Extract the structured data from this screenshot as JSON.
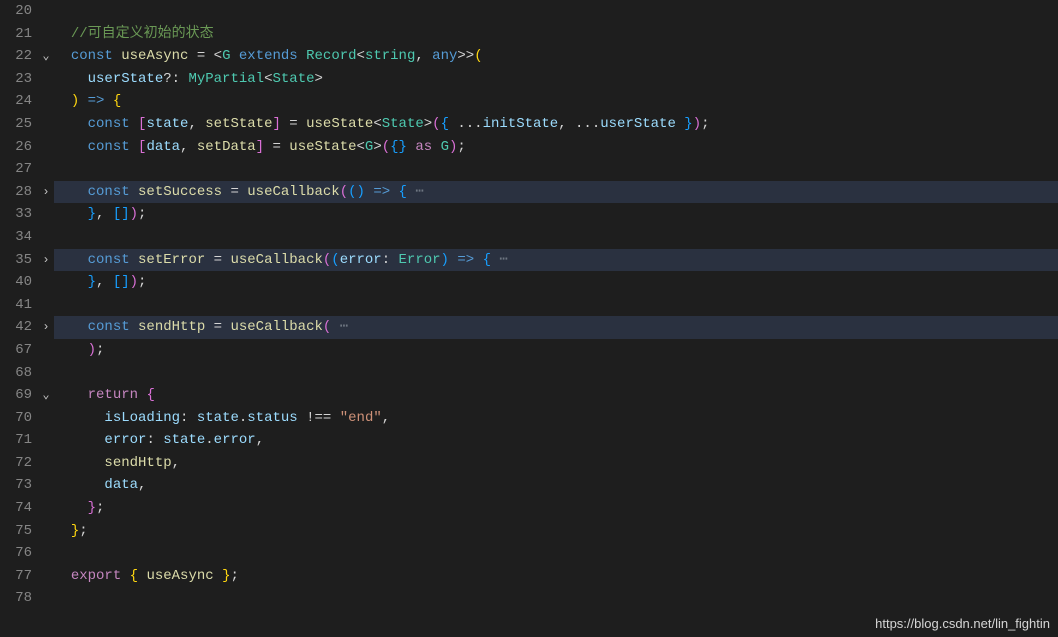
{
  "watermark": "https://blog.csdn.net/lin_fightin",
  "lines": [
    {
      "num": "20",
      "fold": "",
      "hl": false,
      "tokens": []
    },
    {
      "num": "21",
      "fold": "",
      "hl": false,
      "tokens": [
        {
          "t": "  ",
          "c": ""
        },
        {
          "t": "//可自定义初始的状态",
          "c": "comment"
        }
      ]
    },
    {
      "num": "22",
      "fold": "v",
      "hl": false,
      "tokens": [
        {
          "t": "  ",
          "c": ""
        },
        {
          "t": "const",
          "c": "storage"
        },
        {
          "t": " ",
          "c": ""
        },
        {
          "t": "useAsync",
          "c": "func"
        },
        {
          "t": " ",
          "c": ""
        },
        {
          "t": "=",
          "c": "op"
        },
        {
          "t": " ",
          "c": ""
        },
        {
          "t": "<",
          "c": "punc"
        },
        {
          "t": "G",
          "c": "type"
        },
        {
          "t": " ",
          "c": ""
        },
        {
          "t": "extends",
          "c": "storage"
        },
        {
          "t": " ",
          "c": ""
        },
        {
          "t": "Record",
          "c": "type"
        },
        {
          "t": "<",
          "c": "punc"
        },
        {
          "t": "string",
          "c": "type"
        },
        {
          "t": ",",
          "c": "punc"
        },
        {
          "t": " ",
          "c": ""
        },
        {
          "t": "any",
          "c": "storage"
        },
        {
          "t": ">>",
          "c": "punc"
        },
        {
          "t": "(",
          "c": "paren1"
        }
      ]
    },
    {
      "num": "23",
      "fold": "",
      "hl": false,
      "tokens": [
        {
          "t": "    ",
          "c": ""
        },
        {
          "t": "userState",
          "c": "var"
        },
        {
          "t": "?:",
          "c": "punc"
        },
        {
          "t": " ",
          "c": ""
        },
        {
          "t": "MyPartial",
          "c": "type"
        },
        {
          "t": "<",
          "c": "punc"
        },
        {
          "t": "State",
          "c": "type"
        },
        {
          "t": ">",
          "c": "punc"
        }
      ]
    },
    {
      "num": "24",
      "fold": "",
      "hl": false,
      "tokens": [
        {
          "t": "  ",
          "c": ""
        },
        {
          "t": ")",
          "c": "paren1"
        },
        {
          "t": " ",
          "c": ""
        },
        {
          "t": "=>",
          "c": "storage"
        },
        {
          "t": " ",
          "c": ""
        },
        {
          "t": "{",
          "c": "brace"
        }
      ]
    },
    {
      "num": "25",
      "fold": "",
      "hl": false,
      "tokens": [
        {
          "t": "    ",
          "c": ""
        },
        {
          "t": "const",
          "c": "storage"
        },
        {
          "t": " ",
          "c": ""
        },
        {
          "t": "[",
          "c": "bracket"
        },
        {
          "t": "state",
          "c": "var"
        },
        {
          "t": ",",
          "c": "punc"
        },
        {
          "t": " ",
          "c": ""
        },
        {
          "t": "setState",
          "c": "func"
        },
        {
          "t": "]",
          "c": "bracket"
        },
        {
          "t": " ",
          "c": ""
        },
        {
          "t": "=",
          "c": "op"
        },
        {
          "t": " ",
          "c": ""
        },
        {
          "t": "useState",
          "c": "func"
        },
        {
          "t": "<",
          "c": "punc"
        },
        {
          "t": "State",
          "c": "type"
        },
        {
          "t": ">",
          "c": "punc"
        },
        {
          "t": "(",
          "c": "paren2"
        },
        {
          "t": "{",
          "c": "paren3"
        },
        {
          "t": " ",
          "c": ""
        },
        {
          "t": "...",
          "c": "punc"
        },
        {
          "t": "initState",
          "c": "var"
        },
        {
          "t": ",",
          "c": "punc"
        },
        {
          "t": " ",
          "c": ""
        },
        {
          "t": "...",
          "c": "punc"
        },
        {
          "t": "userState",
          "c": "var"
        },
        {
          "t": " ",
          "c": ""
        },
        {
          "t": "}",
          "c": "paren3"
        },
        {
          "t": ")",
          "c": "paren2"
        },
        {
          "t": ";",
          "c": "punc"
        }
      ]
    },
    {
      "num": "26",
      "fold": "",
      "hl": false,
      "tokens": [
        {
          "t": "    ",
          "c": ""
        },
        {
          "t": "const",
          "c": "storage"
        },
        {
          "t": " ",
          "c": ""
        },
        {
          "t": "[",
          "c": "bracket"
        },
        {
          "t": "data",
          "c": "var"
        },
        {
          "t": ",",
          "c": "punc"
        },
        {
          "t": " ",
          "c": ""
        },
        {
          "t": "setData",
          "c": "func"
        },
        {
          "t": "]",
          "c": "bracket"
        },
        {
          "t": " ",
          "c": ""
        },
        {
          "t": "=",
          "c": "op"
        },
        {
          "t": " ",
          "c": ""
        },
        {
          "t": "useState",
          "c": "func"
        },
        {
          "t": "<",
          "c": "punc"
        },
        {
          "t": "G",
          "c": "type"
        },
        {
          "t": ">",
          "c": "punc"
        },
        {
          "t": "(",
          "c": "paren2"
        },
        {
          "t": "{}",
          "c": "paren3"
        },
        {
          "t": " ",
          "c": ""
        },
        {
          "t": "as",
          "c": "keyword"
        },
        {
          "t": " ",
          "c": ""
        },
        {
          "t": "G",
          "c": "type"
        },
        {
          "t": ")",
          "c": "paren2"
        },
        {
          "t": ";",
          "c": "punc"
        }
      ]
    },
    {
      "num": "27",
      "fold": "",
      "hl": false,
      "tokens": []
    },
    {
      "num": "28",
      "fold": ">",
      "hl": true,
      "tokens": [
        {
          "t": "    ",
          "c": ""
        },
        {
          "t": "const",
          "c": "storage"
        },
        {
          "t": " ",
          "c": ""
        },
        {
          "t": "setSuccess",
          "c": "func"
        },
        {
          "t": " ",
          "c": ""
        },
        {
          "t": "=",
          "c": "op"
        },
        {
          "t": " ",
          "c": ""
        },
        {
          "t": "useCallback",
          "c": "func"
        },
        {
          "t": "(",
          "c": "paren2"
        },
        {
          "t": "()",
          "c": "paren3"
        },
        {
          "t": " ",
          "c": ""
        },
        {
          "t": "=>",
          "c": "storage"
        },
        {
          "t": " ",
          "c": ""
        },
        {
          "t": "{",
          "c": "paren3"
        },
        {
          "t": " ⋯",
          "c": "ellipsis"
        }
      ]
    },
    {
      "num": "33",
      "fold": "",
      "hl": false,
      "tokens": [
        {
          "t": "    ",
          "c": ""
        },
        {
          "t": "}",
          "c": "paren3"
        },
        {
          "t": ",",
          "c": "punc"
        },
        {
          "t": " ",
          "c": ""
        },
        {
          "t": "[]",
          "c": "paren3"
        },
        {
          "t": ")",
          "c": "paren2"
        },
        {
          "t": ";",
          "c": "punc"
        }
      ]
    },
    {
      "num": "34",
      "fold": "",
      "hl": false,
      "tokens": []
    },
    {
      "num": "35",
      "fold": ">",
      "hl": true,
      "tokens": [
        {
          "t": "    ",
          "c": ""
        },
        {
          "t": "const",
          "c": "storage"
        },
        {
          "t": " ",
          "c": ""
        },
        {
          "t": "setError",
          "c": "func"
        },
        {
          "t": " ",
          "c": ""
        },
        {
          "t": "=",
          "c": "op"
        },
        {
          "t": " ",
          "c": ""
        },
        {
          "t": "useCallback",
          "c": "func"
        },
        {
          "t": "(",
          "c": "paren2"
        },
        {
          "t": "(",
          "c": "paren3"
        },
        {
          "t": "error",
          "c": "var"
        },
        {
          "t": ":",
          "c": "punc"
        },
        {
          "t": " ",
          "c": ""
        },
        {
          "t": "Error",
          "c": "type"
        },
        {
          "t": ")",
          "c": "paren3"
        },
        {
          "t": " ",
          "c": ""
        },
        {
          "t": "=>",
          "c": "storage"
        },
        {
          "t": " ",
          "c": ""
        },
        {
          "t": "{",
          "c": "paren3"
        },
        {
          "t": " ⋯",
          "c": "ellipsis"
        }
      ]
    },
    {
      "num": "40",
      "fold": "",
      "hl": false,
      "tokens": [
        {
          "t": "    ",
          "c": ""
        },
        {
          "t": "}",
          "c": "paren3"
        },
        {
          "t": ",",
          "c": "punc"
        },
        {
          "t": " ",
          "c": ""
        },
        {
          "t": "[]",
          "c": "paren3"
        },
        {
          "t": ")",
          "c": "paren2"
        },
        {
          "t": ";",
          "c": "punc"
        }
      ]
    },
    {
      "num": "41",
      "fold": "",
      "hl": false,
      "tokens": []
    },
    {
      "num": "42",
      "fold": ">",
      "hl": true,
      "tokens": [
        {
          "t": "    ",
          "c": ""
        },
        {
          "t": "const",
          "c": "storage"
        },
        {
          "t": " ",
          "c": ""
        },
        {
          "t": "sendHttp",
          "c": "func"
        },
        {
          "t": " ",
          "c": ""
        },
        {
          "t": "=",
          "c": "op"
        },
        {
          "t": " ",
          "c": ""
        },
        {
          "t": "useCallback",
          "c": "func"
        },
        {
          "t": "(",
          "c": "paren2"
        },
        {
          "t": " ⋯",
          "c": "ellipsis"
        }
      ]
    },
    {
      "num": "67",
      "fold": "",
      "hl": false,
      "tokens": [
        {
          "t": "    ",
          "c": ""
        },
        {
          "t": ")",
          "c": "paren2"
        },
        {
          "t": ";",
          "c": "punc"
        }
      ]
    },
    {
      "num": "68",
      "fold": "",
      "hl": false,
      "tokens": []
    },
    {
      "num": "69",
      "fold": "v",
      "hl": false,
      "tokens": [
        {
          "t": "    ",
          "c": ""
        },
        {
          "t": "return",
          "c": "keyword"
        },
        {
          "t": " ",
          "c": ""
        },
        {
          "t": "{",
          "c": "paren2"
        }
      ]
    },
    {
      "num": "70",
      "fold": "",
      "hl": false,
      "tokens": [
        {
          "t": "      ",
          "c": ""
        },
        {
          "t": "isLoading",
          "c": "var"
        },
        {
          "t": ":",
          "c": "punc"
        },
        {
          "t": " ",
          "c": ""
        },
        {
          "t": "state",
          "c": "var"
        },
        {
          "t": ".",
          "c": "punc"
        },
        {
          "t": "status",
          "c": "var"
        },
        {
          "t": " ",
          "c": ""
        },
        {
          "t": "!==",
          "c": "op"
        },
        {
          "t": " ",
          "c": ""
        },
        {
          "t": "\"end\"",
          "c": "string"
        },
        {
          "t": ",",
          "c": "punc"
        }
      ]
    },
    {
      "num": "71",
      "fold": "",
      "hl": false,
      "tokens": [
        {
          "t": "      ",
          "c": ""
        },
        {
          "t": "error",
          "c": "var"
        },
        {
          "t": ":",
          "c": "punc"
        },
        {
          "t": " ",
          "c": ""
        },
        {
          "t": "state",
          "c": "var"
        },
        {
          "t": ".",
          "c": "punc"
        },
        {
          "t": "error",
          "c": "var"
        },
        {
          "t": ",",
          "c": "punc"
        }
      ]
    },
    {
      "num": "72",
      "fold": "",
      "hl": false,
      "tokens": [
        {
          "t": "      ",
          "c": ""
        },
        {
          "t": "sendHttp",
          "c": "func"
        },
        {
          "t": ",",
          "c": "punc"
        }
      ]
    },
    {
      "num": "73",
      "fold": "",
      "hl": false,
      "tokens": [
        {
          "t": "      ",
          "c": ""
        },
        {
          "t": "data",
          "c": "var"
        },
        {
          "t": ",",
          "c": "punc"
        }
      ]
    },
    {
      "num": "74",
      "fold": "",
      "hl": false,
      "tokens": [
        {
          "t": "    ",
          "c": ""
        },
        {
          "t": "}",
          "c": "paren2"
        },
        {
          "t": ";",
          "c": "punc"
        }
      ]
    },
    {
      "num": "75",
      "fold": "",
      "hl": false,
      "tokens": [
        {
          "t": "  ",
          "c": ""
        },
        {
          "t": "}",
          "c": "brace"
        },
        {
          "t": ";",
          "c": "punc"
        }
      ]
    },
    {
      "num": "76",
      "fold": "",
      "hl": false,
      "tokens": []
    },
    {
      "num": "77",
      "fold": "",
      "hl": false,
      "tokens": [
        {
          "t": "  ",
          "c": ""
        },
        {
          "t": "export",
          "c": "keyword"
        },
        {
          "t": " ",
          "c": ""
        },
        {
          "t": "{",
          "c": "brace"
        },
        {
          "t": " ",
          "c": ""
        },
        {
          "t": "useAsync",
          "c": "func"
        },
        {
          "t": " ",
          "c": ""
        },
        {
          "t": "}",
          "c": "brace"
        },
        {
          "t": ";",
          "c": "punc"
        }
      ]
    },
    {
      "num": "78",
      "fold": "",
      "hl": false,
      "tokens": []
    }
  ]
}
